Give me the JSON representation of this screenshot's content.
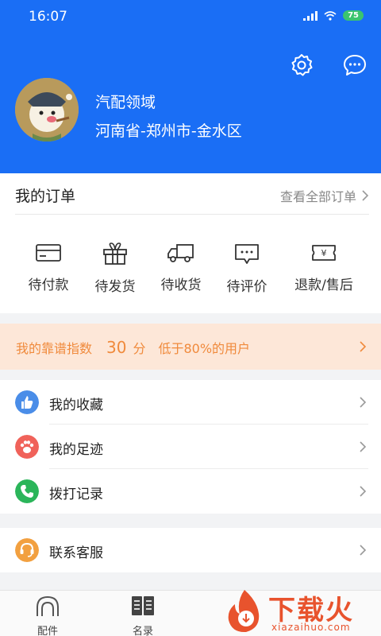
{
  "status_bar": {
    "time": "16:07",
    "battery": "75"
  },
  "profile": {
    "name": "汽配领域",
    "location": "河南省-郑州市-金水区"
  },
  "orders": {
    "title": "我的订单",
    "view_all": "查看全部订单",
    "items": [
      {
        "label": "待付款",
        "icon": "card-icon"
      },
      {
        "label": "待发货",
        "icon": "gift-icon"
      },
      {
        "label": "待收货",
        "icon": "truck-icon"
      },
      {
        "label": "待评价",
        "icon": "comment-icon"
      },
      {
        "label": "退款/售后",
        "icon": "refund-icon"
      }
    ]
  },
  "score": {
    "prefix": "我的靠谱指数",
    "value": "30",
    "unit": "分",
    "suffix": "低于80%的用户"
  },
  "menu": [
    {
      "label": "我的收藏",
      "icon": "favorite-icon",
      "color": "#4a8de8"
    },
    {
      "label": "我的足迹",
      "icon": "paw-icon",
      "color": "#f0625a"
    },
    {
      "label": "拨打记录",
      "icon": "phone-icon",
      "color": "#2bb55a"
    }
  ],
  "menu2": [
    {
      "label": "联系客服",
      "icon": "headset-icon",
      "color": "#f2a040"
    }
  ],
  "tabs": [
    {
      "label": "配件",
      "icon": "headphone-arch-icon"
    },
    {
      "label": "名录",
      "icon": "book-icon"
    }
  ],
  "watermark": {
    "brand": "下载火",
    "url": "xiazaihuo.com"
  },
  "colors": {
    "primary": "#1a6ef5",
    "accent": "#f08a3c",
    "score_bg": "#fde7d8"
  }
}
